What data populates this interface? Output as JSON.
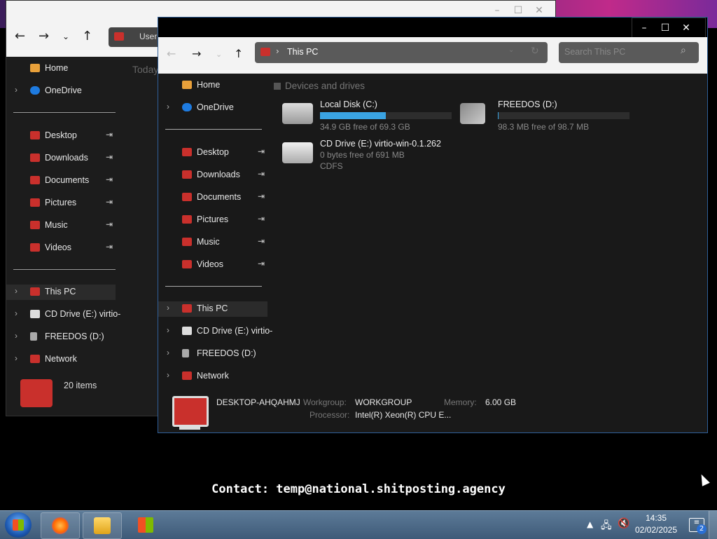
{
  "back_window": {
    "address": "Users",
    "group_label": "Today",
    "sidebar": [
      {
        "label": "Home",
        "icon": "home-icon"
      },
      {
        "label": "OneDrive",
        "icon": "cloud-icon"
      },
      {
        "label": "Desktop",
        "icon": "folder-icon"
      },
      {
        "label": "Downloads",
        "icon": "folder-icon"
      },
      {
        "label": "Documents",
        "icon": "folder-icon"
      },
      {
        "label": "Pictures",
        "icon": "folder-icon"
      },
      {
        "label": "Music",
        "icon": "folder-icon"
      },
      {
        "label": "Videos",
        "icon": "folder-icon"
      },
      {
        "label": "This PC",
        "icon": "pc-icon"
      },
      {
        "label": "CD Drive (E:) virtio-",
        "icon": "cd-icon"
      },
      {
        "label": "FREEDOS (D:)",
        "icon": "usb-icon"
      },
      {
        "label": "Network",
        "icon": "network-icon"
      }
    ],
    "status": "20 items"
  },
  "front_window": {
    "address": "This PC",
    "search_placeholder": "Search This PC",
    "sidebar": [
      {
        "label": "Home"
      },
      {
        "label": "OneDrive"
      },
      {
        "label": "Desktop"
      },
      {
        "label": "Downloads"
      },
      {
        "label": "Documents"
      },
      {
        "label": "Pictures"
      },
      {
        "label": "Music"
      },
      {
        "label": "Videos"
      },
      {
        "label": "This PC"
      },
      {
        "label": "CD Drive (E:) virtio-"
      },
      {
        "label": "FREEDOS (D:)"
      },
      {
        "label": "Network"
      }
    ],
    "group_header": "Devices and drives",
    "drives": [
      {
        "name": "Local Disk (C:)",
        "free": "34.9 GB free of 69.3 GB",
        "used_fraction": 0.5,
        "bar_color": "#3aa3e3"
      },
      {
        "name": "FREEDOS (D:)",
        "free": "98.3 MB free of 98.7 MB",
        "used_fraction": 0.004,
        "bar_color": "#3aa3e3"
      },
      {
        "name": "CD Drive (E:) virtio-win-0.1.262",
        "free": "0 bytes free of 691 MB",
        "fs": "CDFS"
      }
    ],
    "details": {
      "computer_name": "DESKTOP-AHQAHMJ",
      "workgroup_label": "Workgroup:",
      "workgroup": "WORKGROUP",
      "memory_label": "Memory:",
      "memory": "6.00 GB",
      "processor_label": "Processor:",
      "processor": "Intel(R) Xeon(R) CPU E..."
    }
  },
  "overlay": {
    "contact": "Contact: temp@national.shitposting.agency"
  },
  "taskbar": {
    "time": "14:35",
    "date": "02/02/2025",
    "notifications": "2"
  }
}
